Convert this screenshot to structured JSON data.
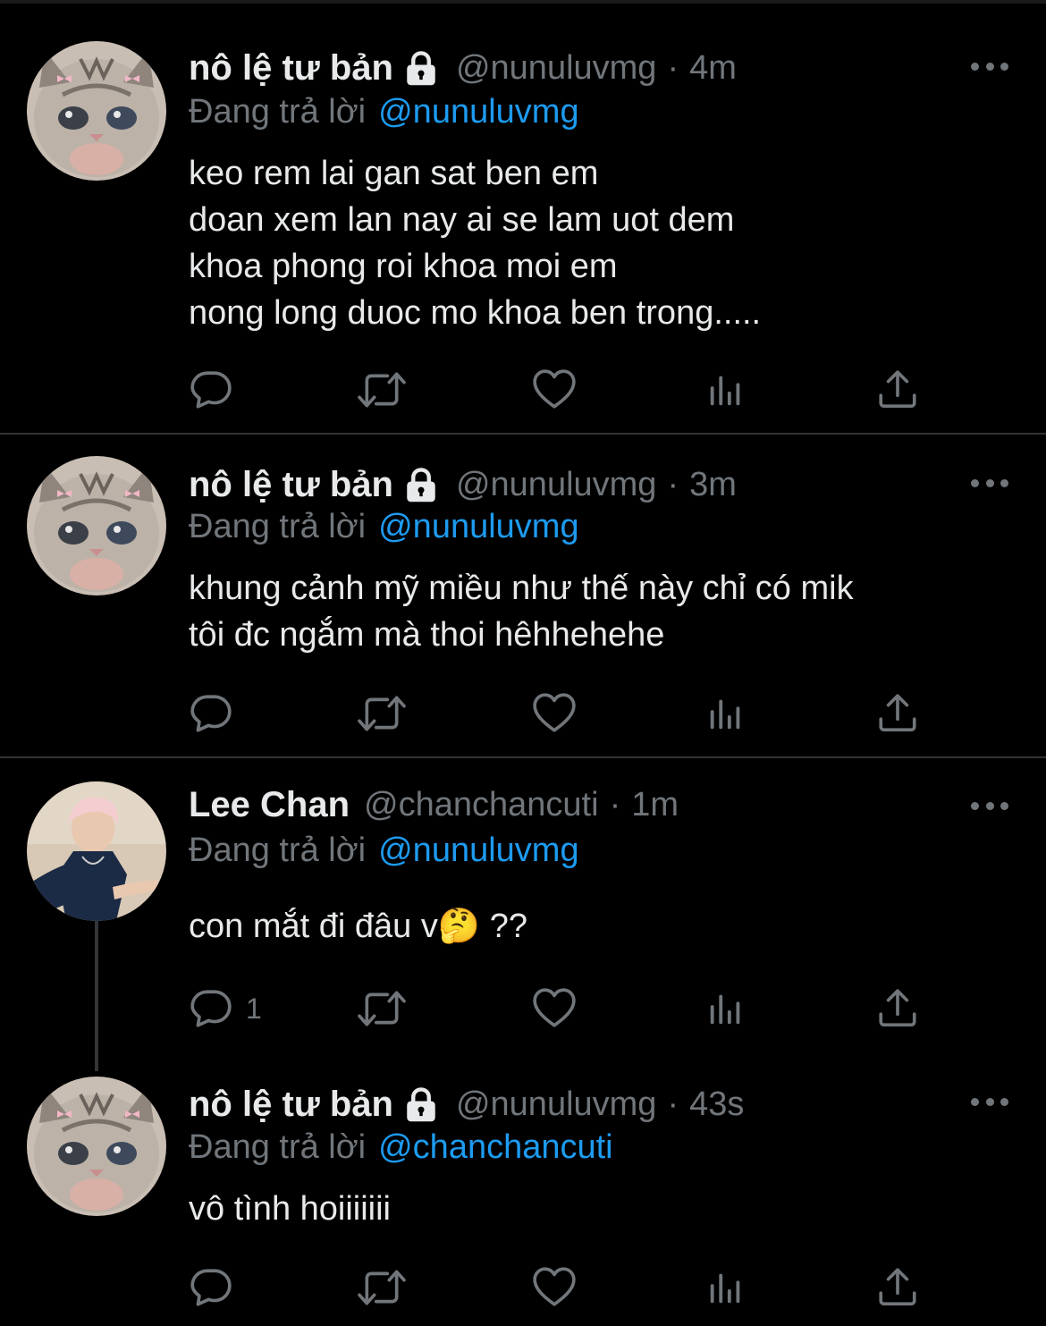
{
  "tweets": [
    {
      "name": "nô lệ tư bản",
      "handle": "@nunuluvmg",
      "separator": "·",
      "time": "4m",
      "reply_prefix": "Đang trả lời",
      "reply_to": "@nunuluvmg",
      "lines": [
        "keo rem lai gan sat ben em",
        "doan xem lan nay ai se lam uot dem",
        "khoa phong roi khoa moi em",
        "nong long duoc mo khoa ben trong....."
      ],
      "reply_count": "",
      "avatar": "cat-avatar",
      "locked": true
    },
    {
      "name": "nô lệ tư bản",
      "handle": "@nunuluvmg",
      "separator": "·",
      "time": "3m",
      "reply_prefix": "Đang trả lời",
      "reply_to": "@nunuluvmg",
      "lines": [
        "khung cảnh mỹ miều như thế này chỉ có mik",
        "tôi đc ngắm mà thoi hêhhehehe"
      ],
      "reply_count": "",
      "avatar": "cat-avatar",
      "locked": true
    },
    {
      "name": "Lee Chan",
      "handle": "@chanchancuti",
      "separator": "·",
      "time": "1m",
      "reply_prefix": "Đang trả lời",
      "reply_to": "@nunuluvmg",
      "lines": [
        "con mắt đi đâu v🤔 ??"
      ],
      "reply_count": "1",
      "avatar": "person-avatar",
      "locked": false
    },
    {
      "name": "nô lệ tư bản",
      "handle": "@nunuluvmg",
      "separator": "·",
      "time": "43s",
      "reply_prefix": "Đang trả lời",
      "reply_to": "@chanchancuti",
      "lines": [
        "vô tình hoiiiiiii"
      ],
      "reply_count": "",
      "avatar": "cat-avatar",
      "locked": true
    }
  ],
  "icons": {
    "reply": "reply-icon",
    "retweet": "retweet-icon",
    "like": "heart-icon",
    "views": "views-icon",
    "share": "share-icon",
    "more": "more-icon",
    "lock": "lock-icon"
  },
  "colors": {
    "background": "#000000",
    "text": "#e7e9ea",
    "muted": "#71767b",
    "link": "#1d9bf0",
    "divider": "#2f3336"
  }
}
